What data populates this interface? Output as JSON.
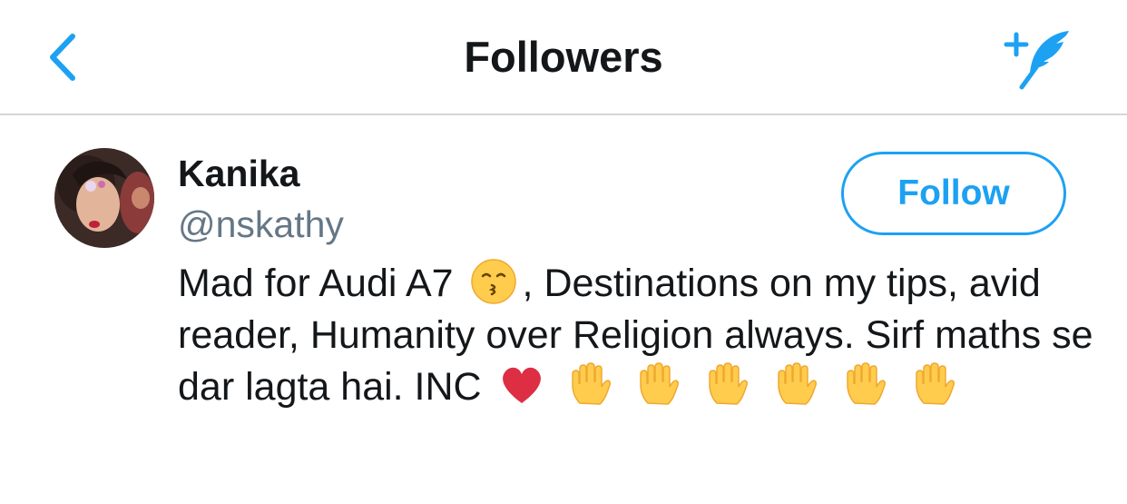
{
  "header": {
    "title": "Followers",
    "back_icon": "chevron-left-icon",
    "compose_icon": "compose-tweet-icon",
    "accent_color": "#1da1f2"
  },
  "user": {
    "name": "Kanika",
    "handle": "@nskathy",
    "follow_label": "Follow",
    "bio": {
      "part1": "Mad for Audi A7",
      "part2": ", Destinations on my tips, avid reader, Humanity over Religion always. Sirf maths se dar lagta hai. INC",
      "emojis": [
        "kissing-face-icon",
        "red-heart-icon",
        "raised-hand-icon"
      ]
    }
  }
}
